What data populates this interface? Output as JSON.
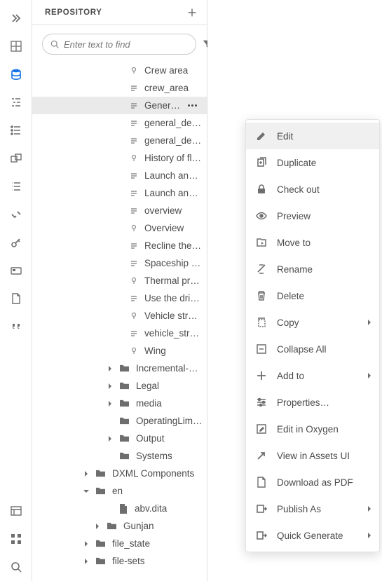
{
  "panel": {
    "title": "REPOSITORY"
  },
  "search": {
    "placeholder": "Enter text to find"
  },
  "rail_icons": [
    "chevrons-right-icon",
    "grid-icon",
    "database-icon",
    "outline-icon",
    "list-icon",
    "reusable-icon",
    "bullets-icon",
    "validate-icon",
    "key-icon",
    "card-icon",
    "page-icon",
    "quote-icon"
  ],
  "rail_bottom_icons": [
    "panel-icon",
    "apps-icon",
    "search-icon"
  ],
  "tree": [
    {
      "indent": 130,
      "type": "lead",
      "label": "Crew area"
    },
    {
      "indent": 130,
      "type": "topic",
      "label": "crew_area"
    },
    {
      "indent": 130,
      "type": "topic",
      "label": "General description",
      "selected": true
    },
    {
      "indent": 130,
      "type": "topic",
      "label": "general_description"
    },
    {
      "indent": 130,
      "type": "topic",
      "label": "general_description"
    },
    {
      "indent": 130,
      "type": "lead",
      "label": "History of flight"
    },
    {
      "indent": 130,
      "type": "topic",
      "label": "Launch and landing site"
    },
    {
      "indent": 130,
      "type": "topic",
      "label": "Launch and landing site"
    },
    {
      "indent": 130,
      "type": "topic",
      "label": "overview"
    },
    {
      "indent": 130,
      "type": "lead",
      "label": "Overview"
    },
    {
      "indent": 130,
      "type": "topic",
      "label": "Recline the seats"
    },
    {
      "indent": 130,
      "type": "topic",
      "label": "Spaceship requirements"
    },
    {
      "indent": 130,
      "type": "lead",
      "label": "Thermal protection"
    },
    {
      "indent": 130,
      "type": "topic",
      "label": "Use the drink dispenser"
    },
    {
      "indent": 130,
      "type": "lead",
      "label": "Vehicle structure"
    },
    {
      "indent": 130,
      "type": "topic",
      "label": "vehicle_structure"
    },
    {
      "indent": 130,
      "type": "lead",
      "label": "Wing"
    },
    {
      "indent": 98,
      "type": "folder",
      "chev": "right",
      "label": "Incremental-output-sample"
    },
    {
      "indent": 98,
      "type": "folder",
      "chev": "right",
      "label": "Legal"
    },
    {
      "indent": 98,
      "type": "folder",
      "chev": "right",
      "label": "media"
    },
    {
      "indent": 98,
      "type": "folder",
      "chev": "blank",
      "label": "OperatingLimitations"
    },
    {
      "indent": 98,
      "type": "folder",
      "chev": "right",
      "label": "Output"
    },
    {
      "indent": 98,
      "type": "folder",
      "chev": "blank",
      "label": "Systems"
    },
    {
      "indent": 64,
      "type": "folder",
      "chev": "right",
      "label": "DXML Components"
    },
    {
      "indent": 64,
      "type": "folder",
      "chev": "down",
      "label": "en"
    },
    {
      "indent": 98,
      "type": "file",
      "chev": "blank",
      "label": "abv.dita"
    },
    {
      "indent": 80,
      "type": "folder",
      "chev": "right",
      "label": "Gunjan"
    },
    {
      "indent": 64,
      "type": "folder",
      "chev": "right",
      "label": "file_state"
    },
    {
      "indent": 64,
      "type": "folder",
      "chev": "right",
      "label": "file-sets"
    }
  ],
  "context_menu": [
    {
      "icon": "pencil-icon",
      "label": "Edit",
      "hover": true
    },
    {
      "icon": "duplicate-icon",
      "label": "Duplicate"
    },
    {
      "icon": "lock-icon",
      "label": "Check out"
    },
    {
      "icon": "eye-icon",
      "label": "Preview"
    },
    {
      "icon": "move-icon",
      "label": "Move to"
    },
    {
      "icon": "rename-icon",
      "label": "Rename"
    },
    {
      "icon": "trash-icon",
      "label": "Delete"
    },
    {
      "icon": "copy-icon",
      "label": "Copy",
      "sub": true
    },
    {
      "icon": "collapse-icon",
      "label": "Collapse All"
    },
    {
      "icon": "plus-icon",
      "label": "Add to",
      "sub": true
    },
    {
      "icon": "sliders-icon",
      "label": "Properties…"
    },
    {
      "icon": "edit-box-icon",
      "label": "Edit in Oxygen"
    },
    {
      "icon": "external-icon",
      "label": "View in Assets UI"
    },
    {
      "icon": "pdf-icon",
      "label": "Download as PDF"
    },
    {
      "icon": "publish-icon",
      "label": "Publish As",
      "sub": true
    },
    {
      "icon": "generate-icon",
      "label": "Quick Generate",
      "sub": true
    }
  ]
}
